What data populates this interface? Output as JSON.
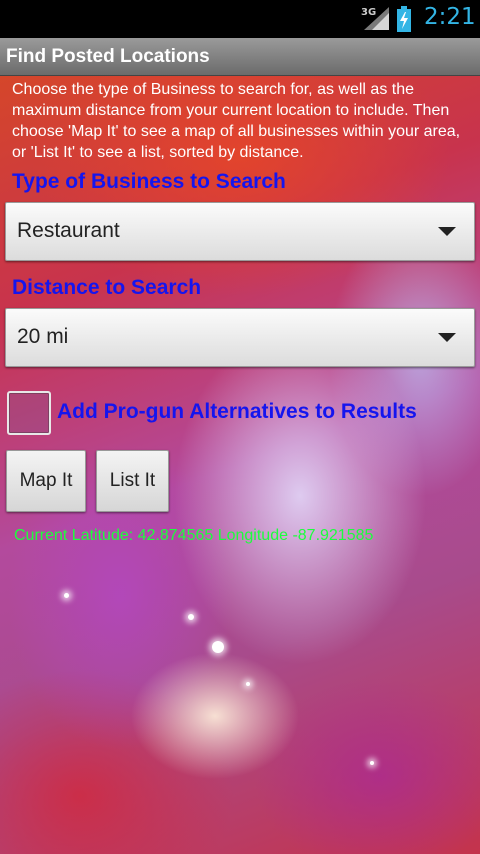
{
  "status_bar": {
    "network": "3G",
    "time": "2:21",
    "accent_color": "#33b5e5",
    "icons": [
      "signal-icon",
      "battery-charging-icon"
    ]
  },
  "app": {
    "title": "Find Posted Locations"
  },
  "intro_text": "Choose the type of Business to search for, as well as the maximum distance from your current location to include. Then choose 'Map It' to see a map of all businesses within your area, or 'List It' to see a list, sorted by distance.",
  "business_type": {
    "label": "Type of Business to Search",
    "selected": "Restaurant"
  },
  "distance": {
    "label": "Distance to Search",
    "selected": "20 mi"
  },
  "alternatives": {
    "label": "Add Pro-gun Alternatives to Results",
    "checked": false
  },
  "buttons": {
    "map": "Map It",
    "list": "List It"
  },
  "location_text": "Current Latitude: 42.874565 Longitude -87.921585",
  "colors": {
    "label_blue": "#1515ee",
    "coords_green": "#1cff3c"
  }
}
